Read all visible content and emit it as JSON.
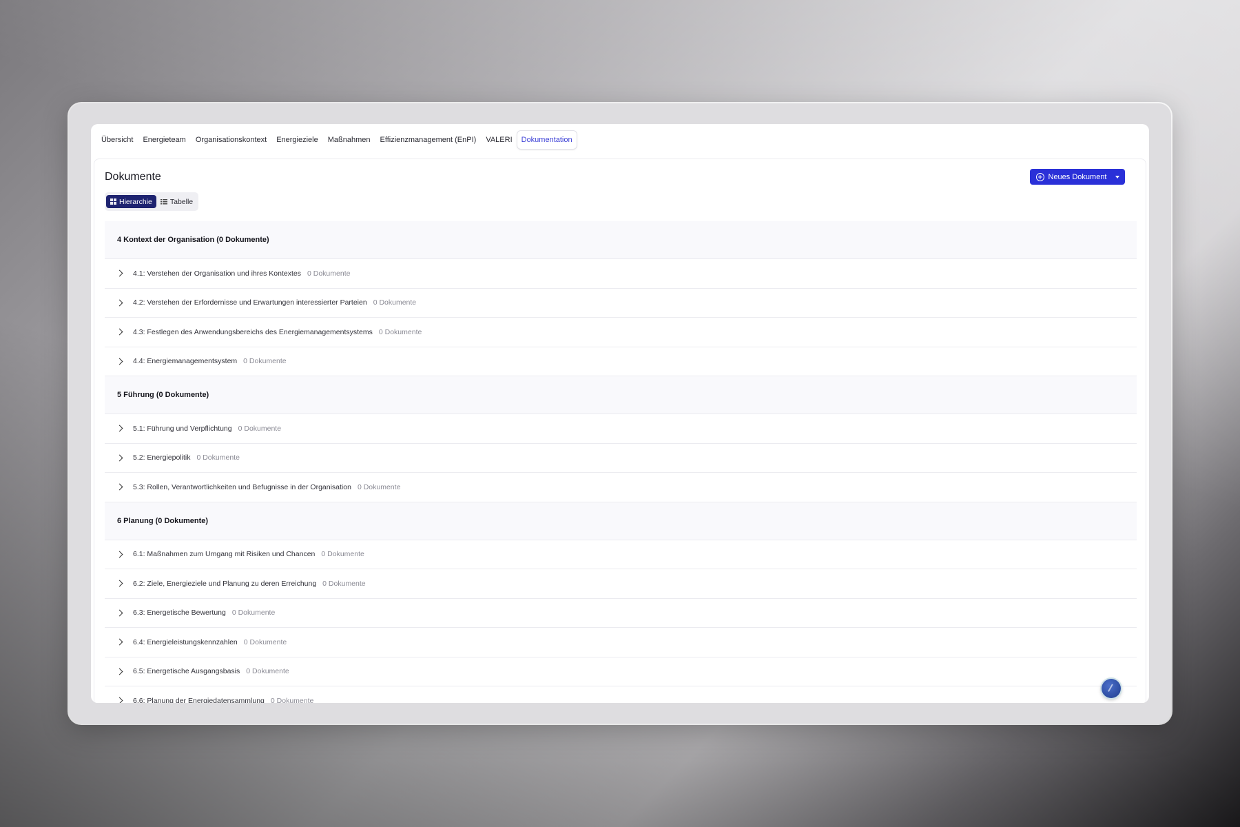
{
  "tabs": [
    {
      "label": "Übersicht",
      "active": false
    },
    {
      "label": "Energieteam",
      "active": false
    },
    {
      "label": "Organisationskontext",
      "active": false
    },
    {
      "label": "Energieziele",
      "active": false
    },
    {
      "label": "Maßnahmen",
      "active": false
    },
    {
      "label": "Effizienzmanagement (EnPI)",
      "active": false
    },
    {
      "label": "VALERI",
      "active": false
    },
    {
      "label": "Dokumentation",
      "active": true
    }
  ],
  "page": {
    "title": "Dokumente",
    "new_document_label": "Neues Dokument",
    "view_toggle": {
      "hierarchy": "Hierarchie",
      "table": "Tabelle",
      "active": "hierarchy"
    }
  },
  "sections": [
    {
      "header": "4 Kontext der Organisation (0 Dokumente)",
      "rows": [
        {
          "label": "4.1: Verstehen der Organisation und ihres Kontextes",
          "count": "0 Dokumente"
        },
        {
          "label": "4.2: Verstehen der Erfordernisse und Erwartungen interessierter Parteien",
          "count": "0 Dokumente"
        },
        {
          "label": "4.3: Festlegen des Anwendungsbereichs des Energiemanagementsystems",
          "count": "0 Dokumente"
        },
        {
          "label": "4.4: Energiemanagementsystem",
          "count": "0 Dokumente"
        }
      ]
    },
    {
      "header": "5 Führung (0 Dokumente)",
      "rows": [
        {
          "label": "5.1: Führung und Verpflichtung",
          "count": "0 Dokumente"
        },
        {
          "label": "5.2: Energiepolitik",
          "count": "0 Dokumente"
        },
        {
          "label": "5.3: Rollen, Verantwortlichkeiten und Befugnisse in der Organisation",
          "count": "0 Dokumente"
        }
      ]
    },
    {
      "header": "6 Planung (0 Dokumente)",
      "rows": [
        {
          "label": "6.1: Maßnahmen zum Umgang mit Risiken und Chancen",
          "count": "0 Dokumente"
        },
        {
          "label": "6.2: Ziele, Energieziele und Planung zu deren Erreichung",
          "count": "0 Dokumente"
        },
        {
          "label": "6.3: Energetische Bewertung",
          "count": "0 Dokumente"
        },
        {
          "label": "6.4: Energieleistungskennzahlen",
          "count": "0 Dokumente"
        },
        {
          "label": "6.5: Energetische Ausgangsbasis",
          "count": "0 Dokumente"
        },
        {
          "label": "6.6: Planung der Energiedatensammlung",
          "count": "0 Dokumente"
        }
      ]
    }
  ],
  "colors": {
    "accent": "#2a30d8",
    "toggle_active": "#1e2370",
    "tab_active_text": "#3b3fd6"
  }
}
